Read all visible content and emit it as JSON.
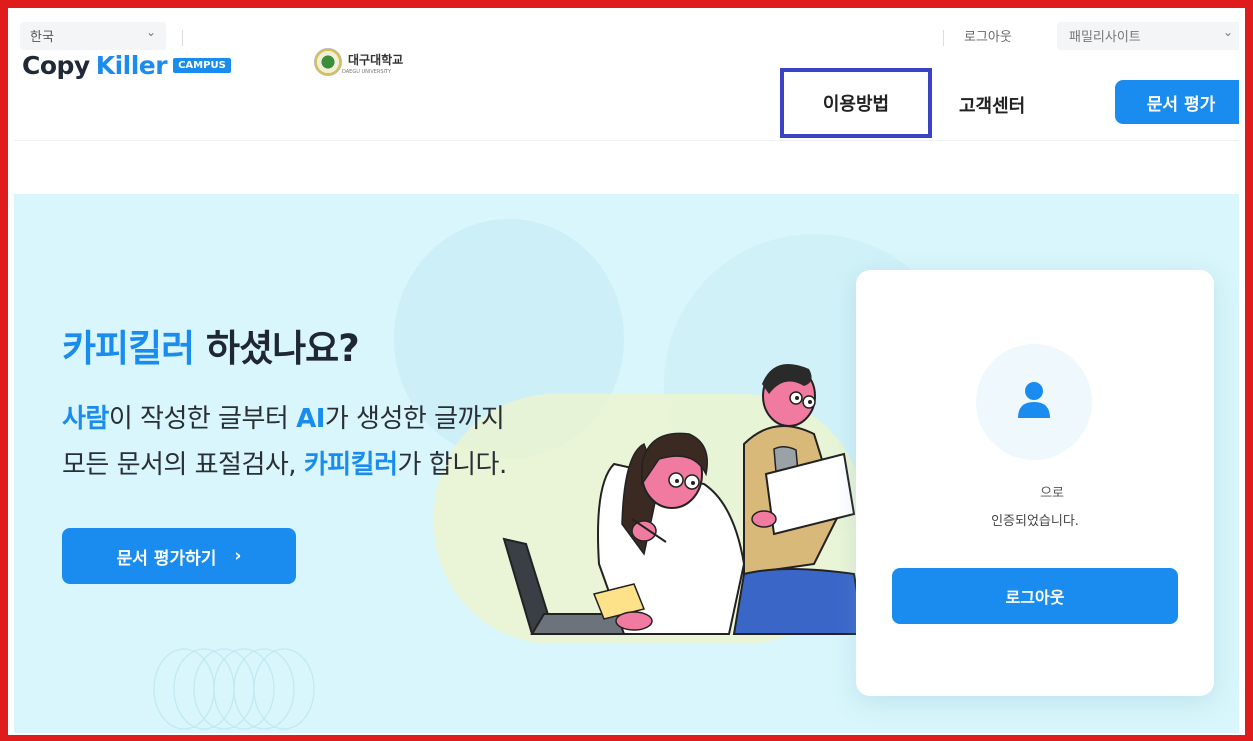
{
  "utility_bar": {
    "language": "한국",
    "logout": "로그아웃",
    "family_site": "패밀리사이트"
  },
  "header": {
    "logo": {
      "copy": "Copy",
      "killer": "Killer",
      "campus": "CAMPUS"
    },
    "university": {
      "name": "대구대학교",
      "sub": "DAEGU UNIVERSITY"
    },
    "nav": {
      "usage": "이용방법",
      "support": "고객센터"
    },
    "evaluate_button": "문서 평가"
  },
  "hero": {
    "title_accent": "카피킬러",
    "title_rest": " 하셨나요?",
    "line1_accent1": "사람",
    "line1_mid": "이 작성한 글부터 ",
    "line1_accent2": "AI",
    "line1_end": "가 생성한 글까지",
    "line2_start": "모든 문서의 표절검사, ",
    "line2_accent": "카피킬러",
    "line2_end": "가 합니다.",
    "cta": "문서 평가하기",
    "cta_arrow": "›"
  },
  "login_card": {
    "suffix": "으로",
    "message": "인증되었습니다.",
    "logout_button": "로그아웃"
  },
  "colors": {
    "accent": "#1a8cf0",
    "frame": "#e01b1b",
    "highlight": "#3b43c4",
    "hero_bg": "#d8f6fb"
  },
  "icons": [
    "chevron-down-icon",
    "user-icon",
    "chevron-right-icon"
  ]
}
